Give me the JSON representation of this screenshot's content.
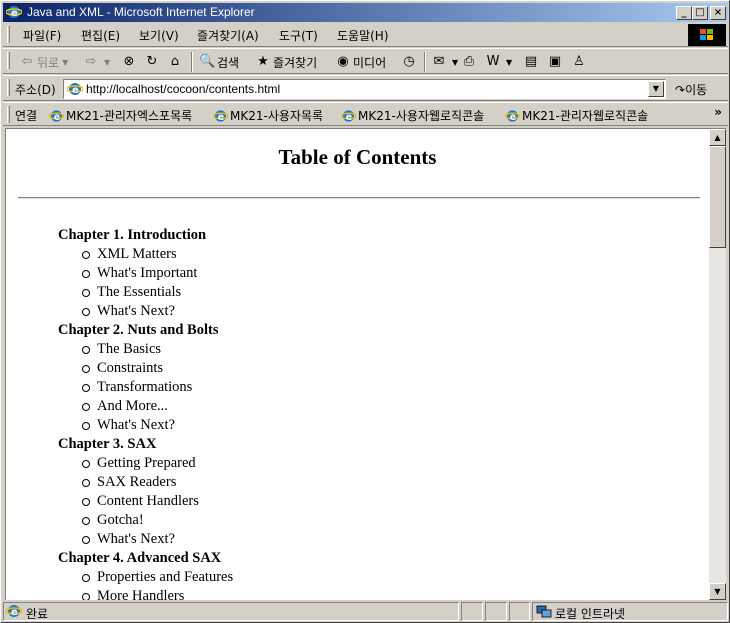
{
  "window": {
    "title": "Java and XML - Microsoft Internet Explorer",
    "minimize": "_",
    "maximize": "□",
    "close": "×"
  },
  "menu": {
    "items": [
      "파일(F)",
      "편집(E)",
      "보기(V)",
      "즐겨찾기(A)",
      "도구(T)",
      "도움말(H)"
    ]
  },
  "toolbar": {
    "back_label": "뒤로",
    "search_label": "검색",
    "favorites_label": "즐겨찾기",
    "media_label": "미디어"
  },
  "address": {
    "label": "주소(D)",
    "url": "http://localhost/cocoon/contents.html",
    "go_label": "이동"
  },
  "links": {
    "label": "연결",
    "items": [
      "MK21-관리자엑스포목록",
      "MK21-사용자목록",
      "MK21-사용자웹로직콘솔",
      "MK21-관리자웹로직콘솔"
    ],
    "more": "»"
  },
  "page": {
    "title": "Table of Contents",
    "chapters": [
      {
        "title": "Chapter 1. Introduction",
        "sections": [
          "XML Matters",
          "What's Important",
          "The Essentials",
          "What's Next?"
        ]
      },
      {
        "title": "Chapter 2. Nuts and Bolts",
        "sections": [
          "The Basics",
          "Constraints",
          "Transformations",
          "And More...",
          "What's Next?"
        ]
      },
      {
        "title": "Chapter 3. SAX",
        "sections": [
          "Getting Prepared",
          "SAX Readers",
          "Content Handlers",
          "Gotcha!",
          "What's Next?"
        ]
      },
      {
        "title": "Chapter 4. Advanced SAX",
        "sections": [
          "Properties and Features",
          "More Handlers"
        ]
      }
    ]
  },
  "status": {
    "text": "완료",
    "zone": "로컬 인트라넷"
  }
}
